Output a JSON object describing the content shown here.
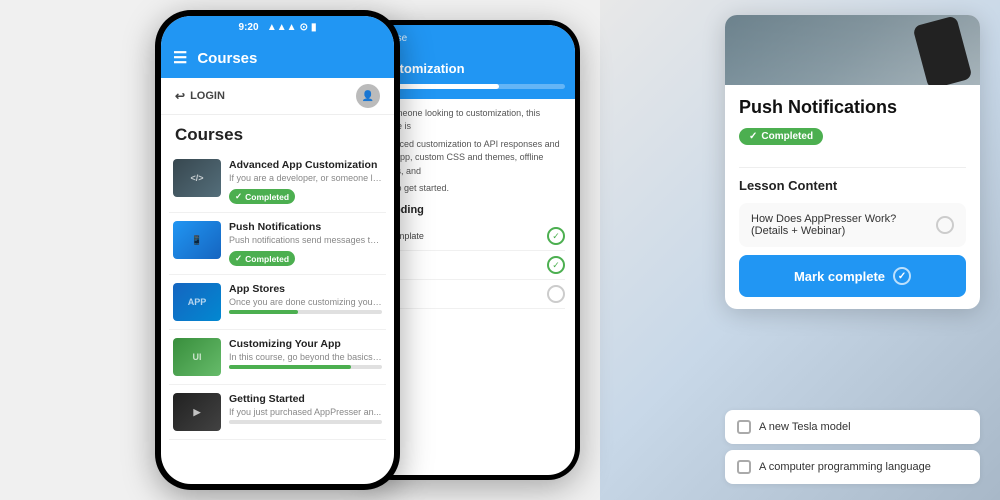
{
  "background": {
    "color": "#f0f0f0"
  },
  "phone_left": {
    "status_bar": {
      "time": "9:20",
      "signal": "●●●",
      "wifi": "wifi",
      "battery": "battery"
    },
    "nav": {
      "title": "Courses"
    },
    "login_bar": {
      "label": "LOGIN"
    },
    "page_title": "Courses",
    "courses": [
      {
        "name": "Advanced App Customization",
        "desc": "If you are a developer, or someone lo...",
        "status": "completed",
        "thumb_class": "gray-code",
        "thumb_label": "</>"
      },
      {
        "name": "Push Notifications",
        "desc": "Push notifications send messages to ...",
        "status": "completed",
        "thumb_class": "blue",
        "thumb_label": "📱"
      },
      {
        "name": "App Stores",
        "desc": "Once you are done customizing your ...",
        "status": "progress",
        "progress": 45,
        "thumb_class": "app-store",
        "thumb_label": "APP"
      },
      {
        "name": "Customizing Your App",
        "desc": "In this course, go beyond the basics ...",
        "status": "check",
        "thumb_class": "green-ui",
        "thumb_label": "UI"
      },
      {
        "name": "Getting Started",
        "desc": "If you just purchased AppPresser an...",
        "status": "empty",
        "thumb_class": "dark",
        "thumb_label": "▶"
      }
    ],
    "completed_label": "Completed"
  },
  "phone_mid": {
    "course_label": "Course",
    "course_title": "App\nCustomization",
    "progress": 65,
    "body_text": "If you are a developer, or someone looking to customize...",
    "detail_text": "or someone looking to customization, this course is",
    "detail_text2": "advanced customization to API responses and your app, custom CSS and themes, offline assets, and",
    "detail_text3": "how to get started.",
    "section_label": "& Coding",
    "lesson1": "nd Template",
    "lessons": [
      {
        "title": "& Coding",
        "done": true
      },
      {
        "title": "nd Template",
        "done": true
      },
      {
        "title": "",
        "done": false
      }
    ]
  },
  "card": {
    "title": "Push Notifications",
    "completed_label": "Completed",
    "lesson_content_title": "Lesson Content",
    "lesson_item": {
      "title": "How Does AppPresser Work?\n(Details + Webinar)"
    },
    "mark_complete_label": "Mark complete"
  },
  "quiz_items": [
    {
      "text": "A new Tesla model"
    },
    {
      "text": "A computer programming language"
    }
  ]
}
